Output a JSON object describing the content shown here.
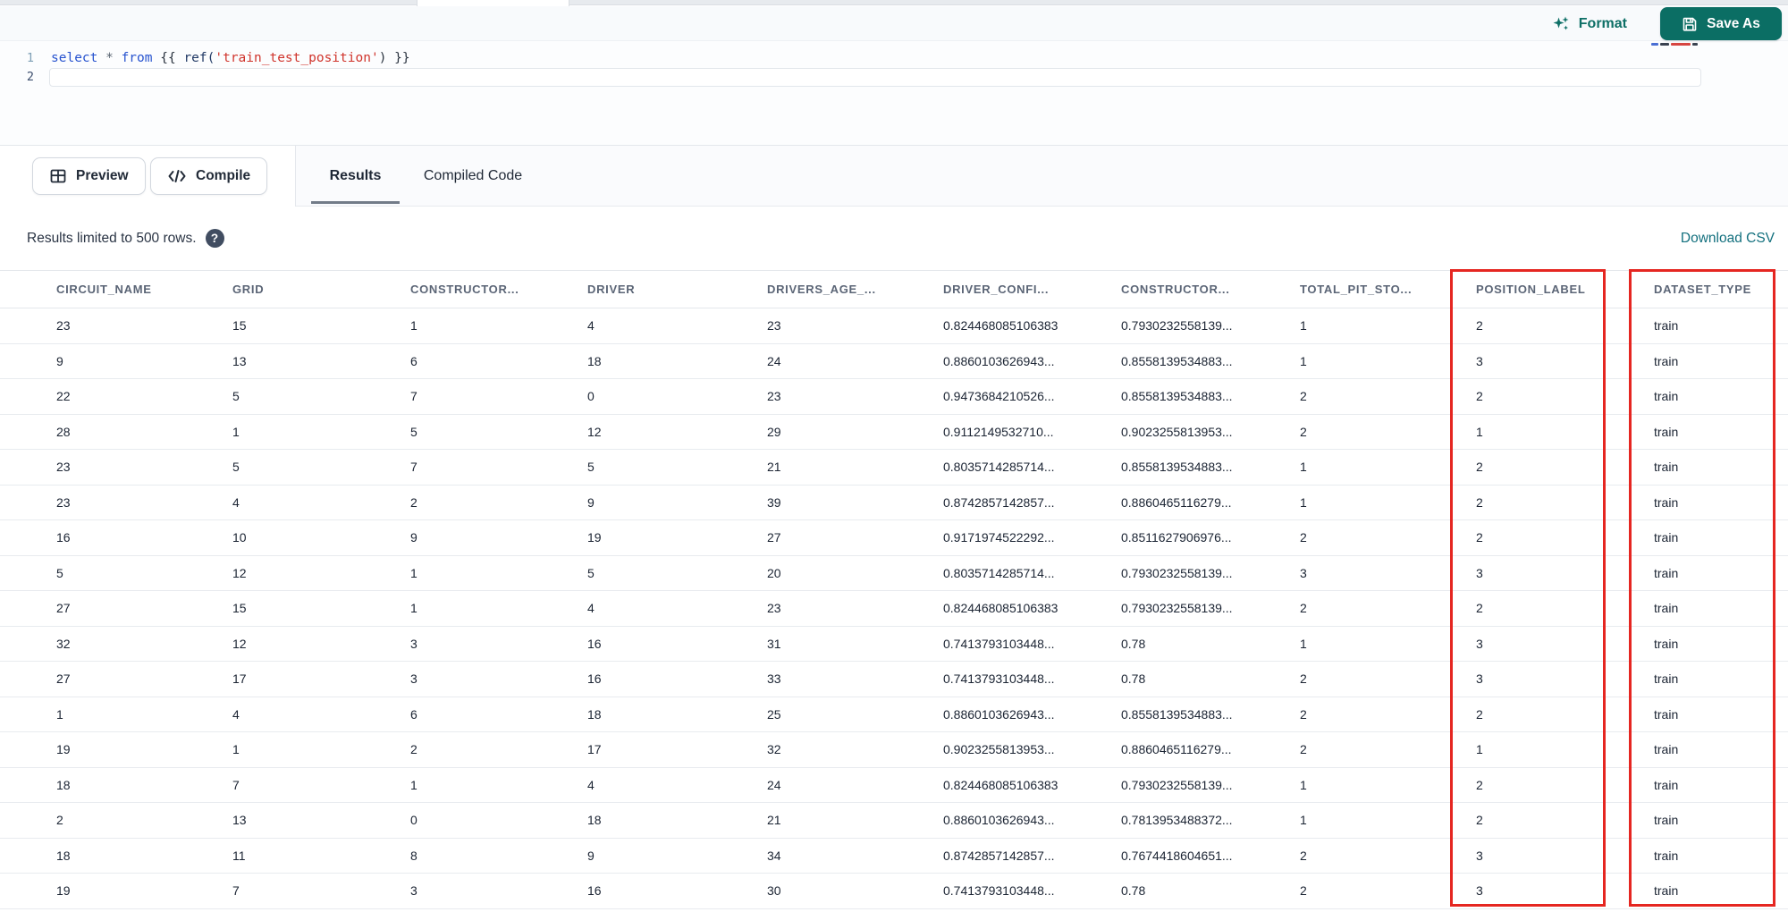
{
  "editor": {
    "format_label": "Format",
    "save_as_label": "Save As",
    "line_numbers": {
      "l1": "1",
      "l2": "2"
    },
    "code": {
      "kw_select": "select ",
      "op_star": "* ",
      "kw_from": "from ",
      "jinja_open": "{{ ",
      "fn_ref": "ref(",
      "str_model": "'train_test_position'",
      "jinja_close": ") }}"
    }
  },
  "toolbar": {
    "preview_label": "Preview",
    "compile_label": "Compile"
  },
  "tabs": {
    "results_label": "Results",
    "compiled_code_label": "Compiled Code"
  },
  "results": {
    "limit_note": "Results limited to 500 rows.",
    "help_glyph": "?",
    "download_csv_label": "Download CSV",
    "table": {
      "columns": [
        "CIRCUIT_NAME",
        "GRID",
        "CONSTRUCTOR...",
        "DRIVER",
        "DRIVERS_AGE_...",
        "DRIVER_CONFI...",
        "CONSTRUCTOR...",
        "TOTAL_PIT_STO...",
        "POSITION_LABEL",
        "DATASET_TYPE"
      ],
      "rows": [
        [
          "23",
          "15",
          "1",
          "4",
          "23",
          "0.824468085106383",
          "0.7930232558139...",
          "1",
          "2",
          "train"
        ],
        [
          "9",
          "13",
          "6",
          "18",
          "24",
          "0.8860103626943...",
          "0.8558139534883...",
          "1",
          "3",
          "train"
        ],
        [
          "22",
          "5",
          "7",
          "0",
          "23",
          "0.9473684210526...",
          "0.8558139534883...",
          "2",
          "2",
          "train"
        ],
        [
          "28",
          "1",
          "5",
          "12",
          "29",
          "0.9112149532710...",
          "0.9023255813953...",
          "2",
          "1",
          "train"
        ],
        [
          "23",
          "5",
          "7",
          "5",
          "21",
          "0.8035714285714...",
          "0.8558139534883...",
          "1",
          "2",
          "train"
        ],
        [
          "23",
          "4",
          "2",
          "9",
          "39",
          "0.8742857142857...",
          "0.8860465116279...",
          "1",
          "2",
          "train"
        ],
        [
          "16",
          "10",
          "9",
          "19",
          "27",
          "0.9171974522292...",
          "0.8511627906976...",
          "2",
          "2",
          "train"
        ],
        [
          "5",
          "12",
          "1",
          "5",
          "20",
          "0.8035714285714...",
          "0.7930232558139...",
          "3",
          "3",
          "train"
        ],
        [
          "27",
          "15",
          "1",
          "4",
          "23",
          "0.824468085106383",
          "0.7930232558139...",
          "2",
          "2",
          "train"
        ],
        [
          "32",
          "12",
          "3",
          "16",
          "31",
          "0.7413793103448...",
          "0.78",
          "1",
          "3",
          "train"
        ],
        [
          "27",
          "17",
          "3",
          "16",
          "33",
          "0.7413793103448...",
          "0.78",
          "2",
          "3",
          "train"
        ],
        [
          "1",
          "4",
          "6",
          "18",
          "25",
          "0.8860103626943...",
          "0.8558139534883...",
          "2",
          "2",
          "train"
        ],
        [
          "19",
          "1",
          "2",
          "17",
          "32",
          "0.9023255813953...",
          "0.8860465116279...",
          "2",
          "1",
          "train"
        ],
        [
          "18",
          "7",
          "1",
          "4",
          "24",
          "0.824468085106383",
          "0.7930232558139...",
          "1",
          "2",
          "train"
        ],
        [
          "2",
          "13",
          "0",
          "18",
          "21",
          "0.8860103626943...",
          "0.7813953488372...",
          "1",
          "2",
          "train"
        ],
        [
          "18",
          "11",
          "8",
          "9",
          "34",
          "0.8742857142857...",
          "0.7674418604651...",
          "2",
          "3",
          "train"
        ],
        [
          "19",
          "7",
          "3",
          "16",
          "30",
          "0.7413793103448...",
          "0.78",
          "2",
          "3",
          "train"
        ]
      ]
    }
  },
  "annotations": {
    "highlight_color": "#e52621",
    "highlighted_columns": [
      "POSITION_LABEL",
      "DATASET_TYPE"
    ]
  },
  "colors": {
    "accent_teal": "#0b6e64",
    "link_teal": "#13707e"
  }
}
